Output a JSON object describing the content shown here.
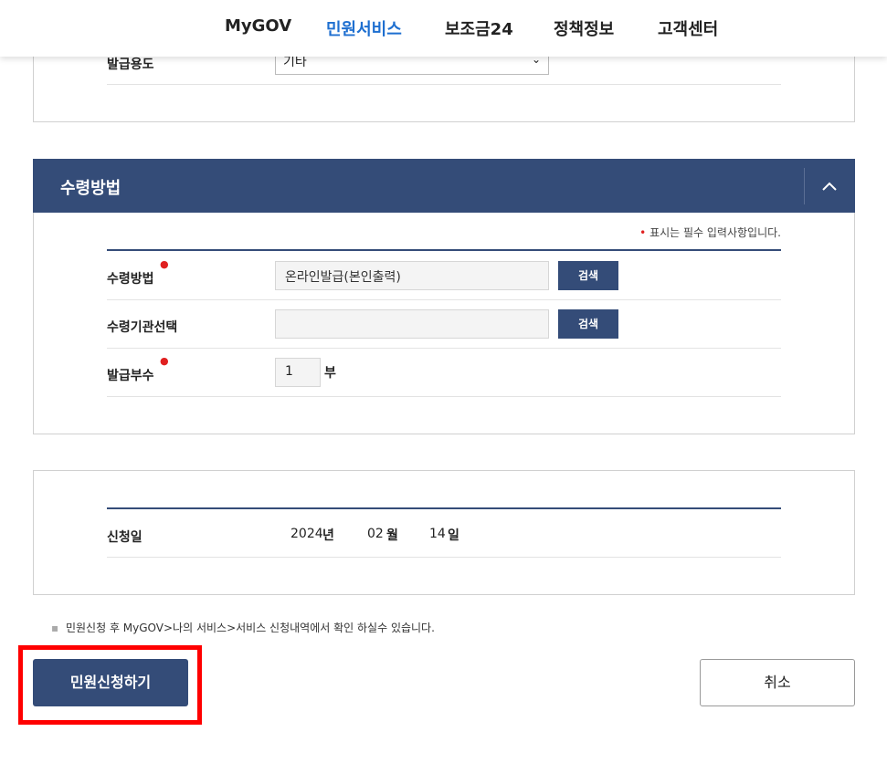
{
  "nav": {
    "items": [
      "MyGOV",
      "민원서비스",
      "보조금24",
      "정책정보",
      "고객센터"
    ],
    "active_index": 1
  },
  "purpose_row": {
    "label": "발급용도",
    "select_value": "기타"
  },
  "receive_section": {
    "title": "수령방법",
    "required_note": "표시는 필수 입력사항입니다.",
    "rows": {
      "method": {
        "label": "수령방법",
        "value": "온라인발급(본인출력)",
        "button": "검색"
      },
      "agency": {
        "label": "수령기관선택",
        "value": "",
        "button": "검색"
      },
      "copies": {
        "label": "발급부수",
        "value": "1",
        "unit": "부"
      }
    }
  },
  "apply_date": {
    "label": "신청일",
    "year": "2024",
    "year_unit": "년",
    "month": "02",
    "month_unit": "월",
    "day": "14",
    "day_unit": "일"
  },
  "info_note": "민원신청 후 MyGOV>나의 서비스>서비스 신청내역에서 확인 하실수 있습니다.",
  "actions": {
    "submit": "민원신청하기",
    "cancel": "취소"
  },
  "colors": {
    "primary": "#344c78",
    "nav_active": "#1e6fd0",
    "required": "#e02020",
    "highlight": "#ff0000"
  }
}
